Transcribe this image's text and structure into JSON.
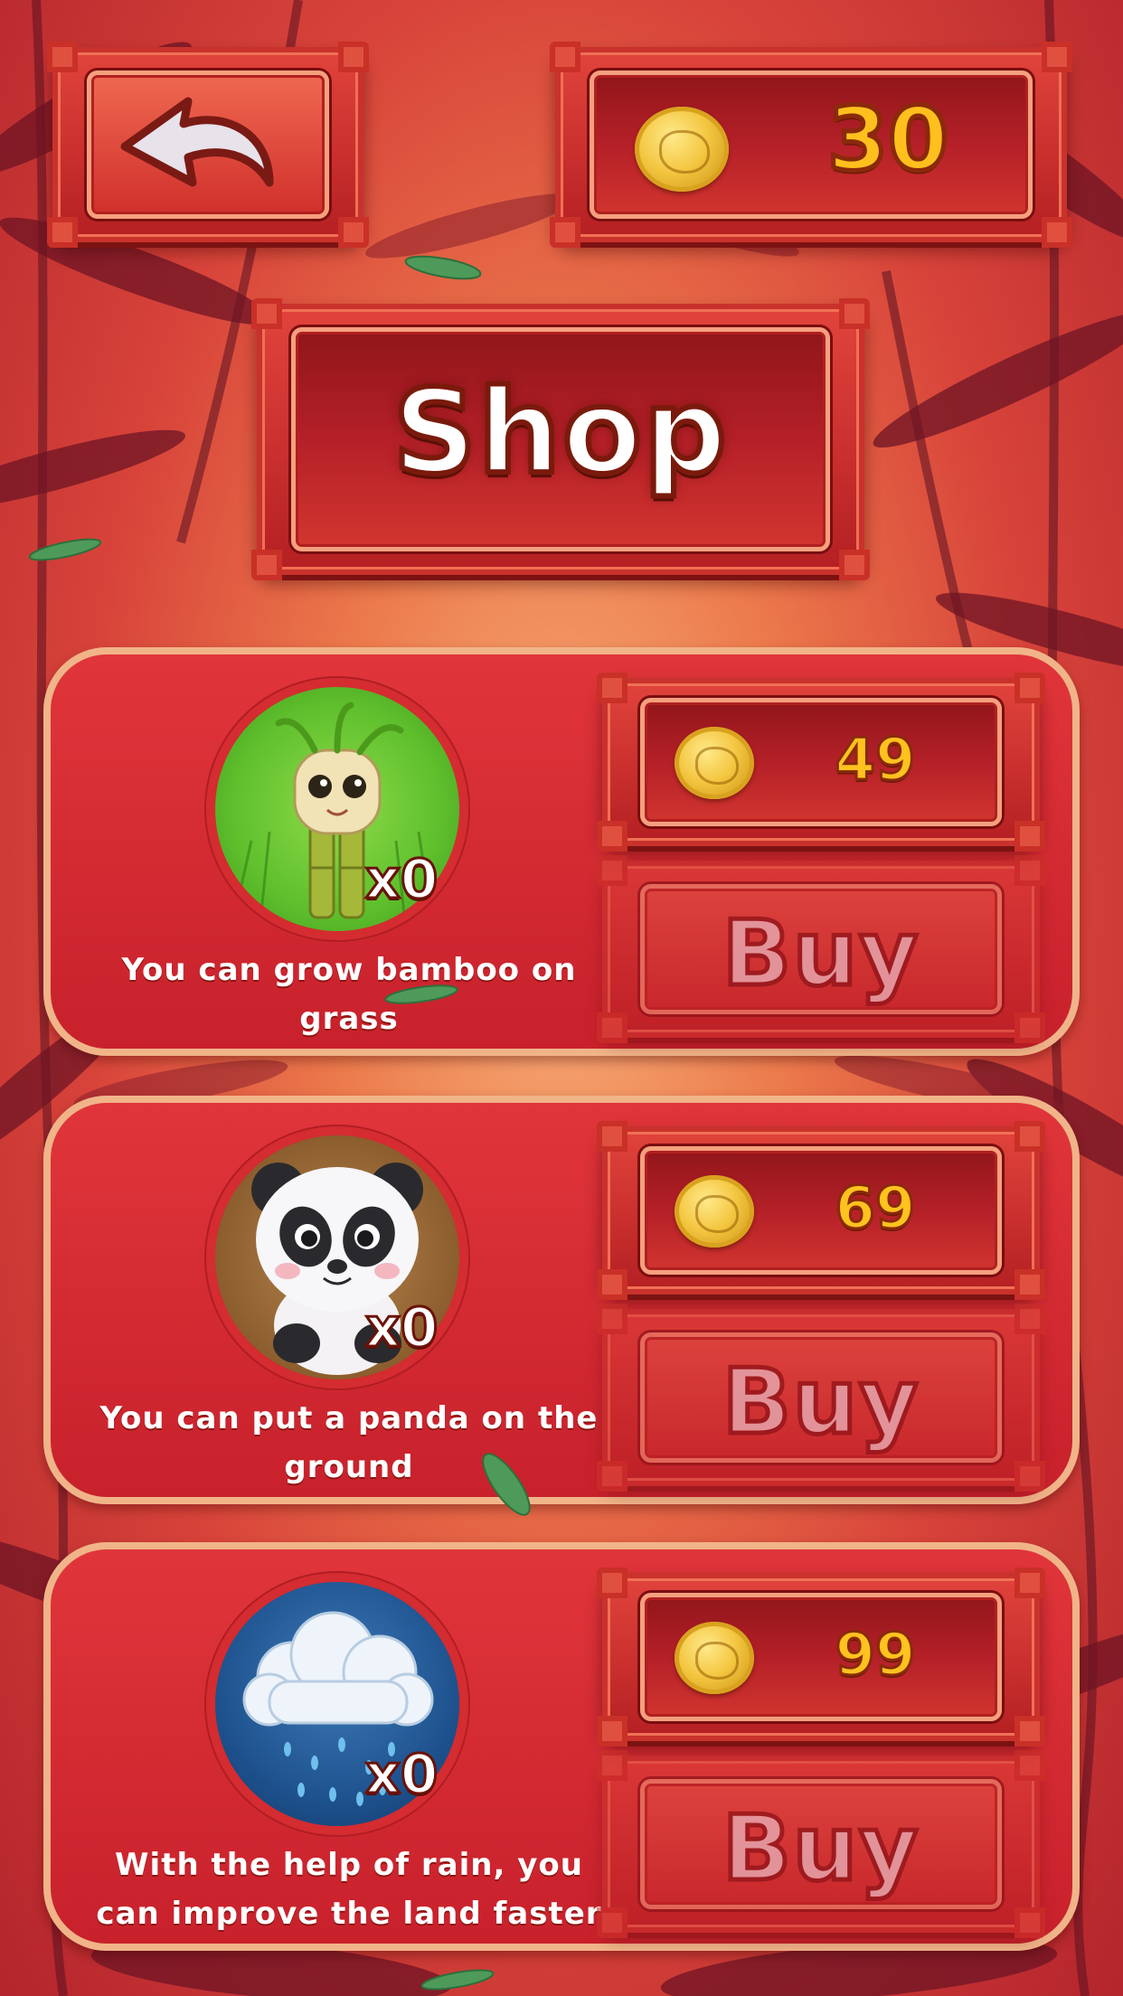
{
  "header": {
    "coin_count": "30",
    "back_icon": "back-arrow-icon",
    "coin_icon": "gold-coin-icon"
  },
  "title": "Shop",
  "items": [
    {
      "icon": "bamboo-sprout-icon",
      "quantity": "x0",
      "description": "You can grow bamboo on grass",
      "price": "49",
      "buy_label": "Buy"
    },
    {
      "icon": "panda-icon",
      "quantity": "x0",
      "description": "You can put a panda on the ground",
      "price": "69",
      "buy_label": "Buy"
    },
    {
      "icon": "rain-cloud-icon",
      "quantity": "x0",
      "description": "With the help of rain, you can improve the land faster",
      "price": "99",
      "buy_label": "Buy"
    }
  ],
  "colors": {
    "background": "#d8443a",
    "card": "#d42a32",
    "card_border": "#f1b489",
    "coin_text": "#ffc01e"
  }
}
